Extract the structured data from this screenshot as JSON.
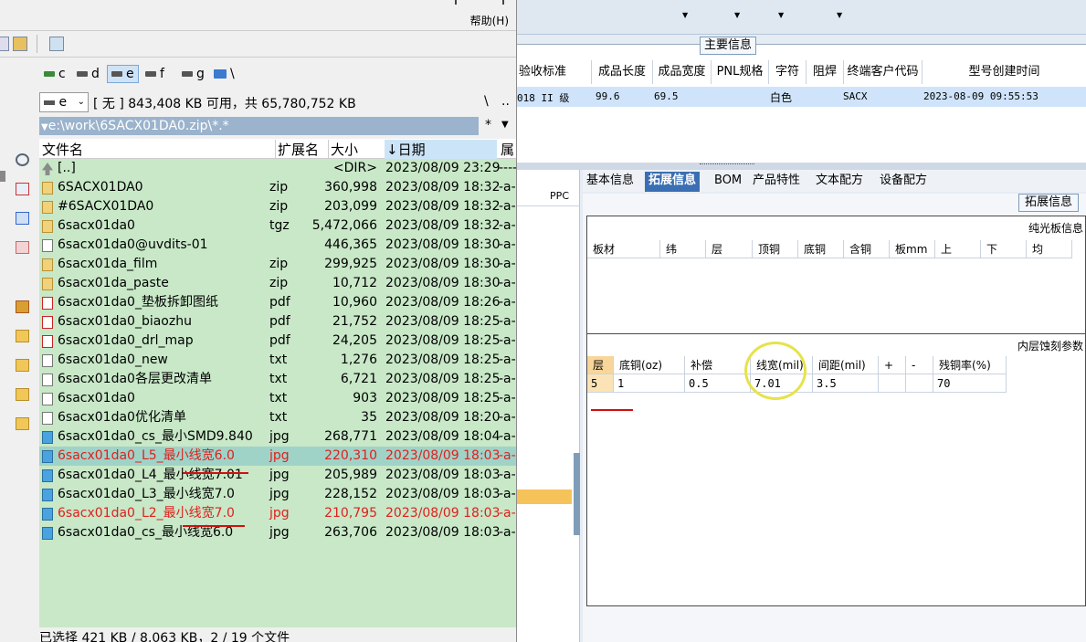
{
  "tc": {
    "help_menu": "帮助(H)",
    "drives": [
      "c",
      "d",
      "e",
      "f",
      "g",
      "\\"
    ],
    "drive_select": "e",
    "free_info": "[ 无 ]  843,408 KB 可用，共 65,780,752 KB",
    "path": "e:\\work\\6SACX01DA0.zip\\*.*",
    "root_btn": "\\",
    "up_btn": "..",
    "star_btn": "*",
    "columns": {
      "name": "文件名",
      "ext": "扩展名",
      "size": "大小",
      "date": "↓日期",
      "attr": "属"
    },
    "files": [
      {
        "name": "[..]",
        "ext": "",
        "size": "<DIR>",
        "date": "2023/08/09 23:29",
        "attr": "----",
        "icon": "up-folder-icon"
      },
      {
        "name": "6SACX01DA0",
        "ext": "zip",
        "size": "360,998",
        "date": "2023/08/09 18:32",
        "attr": "-a-",
        "icon": "zip-icon"
      },
      {
        "name": "#6SACX01DA0",
        "ext": "zip",
        "size": "203,099",
        "date": "2023/08/09 18:32",
        "attr": "-a-",
        "icon": "zip-icon"
      },
      {
        "name": "6sacx01da0",
        "ext": "tgz",
        "size": "5,472,066",
        "date": "2023/08/09 18:32",
        "attr": "-a-",
        "icon": "zip-icon"
      },
      {
        "name": "6sacx01da0@uvdits-01",
        "ext": "",
        "size": "446,365",
        "date": "2023/08/09 18:30",
        "attr": "-a-",
        "icon": "file-icon"
      },
      {
        "name": "6sacx01da_film",
        "ext": "zip",
        "size": "299,925",
        "date": "2023/08/09 18:30",
        "attr": "-a-",
        "icon": "zip-icon"
      },
      {
        "name": "6sacx01da_paste",
        "ext": "zip",
        "size": "10,712",
        "date": "2023/08/09 18:30",
        "attr": "-a-",
        "icon": "zip-icon"
      },
      {
        "name": "6sacx01da0_垫板拆卸图纸",
        "ext": "pdf",
        "size": "10,960",
        "date": "2023/08/09 18:26",
        "attr": "-a-",
        "icon": "pdf-icon"
      },
      {
        "name": "6sacx01da0_biaozhu",
        "ext": "pdf",
        "size": "21,752",
        "date": "2023/08/09 18:25",
        "attr": "-a-",
        "icon": "pdf-icon"
      },
      {
        "name": "6sacx01da0_drl_map",
        "ext": "pdf",
        "size": "24,205",
        "date": "2023/08/09 18:25",
        "attr": "-a-",
        "icon": "pdf-icon"
      },
      {
        "name": "6sacx01da0_new",
        "ext": "txt",
        "size": "1,276",
        "date": "2023/08/09 18:25",
        "attr": "-a-",
        "icon": "txt-icon"
      },
      {
        "name": "6sacx01da0各层更改清单",
        "ext": "txt",
        "size": "6,721",
        "date": "2023/08/09 18:25",
        "attr": "-a-",
        "icon": "txt-icon"
      },
      {
        "name": "6sacx01da0",
        "ext": "txt",
        "size": "903",
        "date": "2023/08/09 18:25",
        "attr": "-a-",
        "icon": "txt-icon"
      },
      {
        "name": "6sacx01da0优化清单",
        "ext": "txt",
        "size": "35",
        "date": "2023/08/09 18:20",
        "attr": "-a-",
        "icon": "txt-icon"
      },
      {
        "name": "6sacx01da0_cs_最小SMD9.840",
        "ext": "jpg",
        "size": "268,771",
        "date": "2023/08/09 18:04",
        "attr": "-a-",
        "icon": "image-icon"
      },
      {
        "name": "6sacx01da0_L5_最小线宽6.0",
        "ext": "jpg",
        "size": "220,310",
        "date": "2023/08/09 18:03",
        "attr": "-a-",
        "icon": "image-icon",
        "marked": true,
        "cursor": true
      },
      {
        "name": "6sacx01da0_L4_最小线宽7.01",
        "ext": "jpg",
        "size": "205,989",
        "date": "2023/08/09 18:03",
        "attr": "-a-",
        "icon": "image-icon"
      },
      {
        "name": "6sacx01da0_L3_最小线宽7.0",
        "ext": "jpg",
        "size": "228,152",
        "date": "2023/08/09 18:03",
        "attr": "-a-",
        "icon": "image-icon"
      },
      {
        "name": "6sacx01da0_L2_最小线宽7.0",
        "ext": "jpg",
        "size": "210,795",
        "date": "2023/08/09 18:03",
        "attr": "-a-",
        "icon": "image-icon",
        "marked": true
      },
      {
        "name": "6sacx01da0_cs_最小线宽6.0",
        "ext": "jpg",
        "size": "263,706",
        "date": "2023/08/09 18:03",
        "attr": "-a-",
        "icon": "image-icon"
      }
    ],
    "status": "已选择 421 KB / 8,063 KB，2 / 19 个文件"
  },
  "erp": {
    "main_info_legend": "主要信息",
    "main_columns": [
      "验收标准",
      "成品长度",
      "成品宽度",
      "PNL规格",
      "字符",
      "阻焊",
      "终端客户代码",
      "型号创建时间"
    ],
    "main_row": [
      "018 II 级",
      "99.6",
      "69.5",
      "",
      "",
      "白色",
      "SACX",
      "2023-08-09 09:55:53"
    ],
    "left_col_header": "PPC",
    "tabs": [
      "基本信息",
      "拓展信息",
      "BOM",
      "产品特性",
      "文本配方",
      "设备配方"
    ],
    "active_tab": "拓展信息",
    "ext_legend": "拓展信息",
    "bare_board_title": "纯光板信息",
    "bare_board_columns": [
      "板材",
      "纬",
      "层",
      "顶铜",
      "底铜",
      "含铜",
      "板mm",
      "上",
      "下",
      "均"
    ],
    "etch_title": "内层蚀刻参数",
    "etch_columns": [
      "层",
      "底铜(oz)",
      "补偿",
      "线宽(mil)",
      "间距(mil)",
      "+",
      "-",
      "残铜率(%)"
    ],
    "etch_row": [
      "5",
      "1",
      "0.5",
      "7.01",
      "3.5",
      "",
      "",
      "70"
    ]
  },
  "colors": {
    "list_bg": "#c8e8c8",
    "cursor_bg": "#9fd3c8",
    "marked_text": "#e0201c",
    "path_bar": "#9bb3cc",
    "tab_active": "#3b6fb3",
    "highlight_ring": "#e6e34a"
  }
}
